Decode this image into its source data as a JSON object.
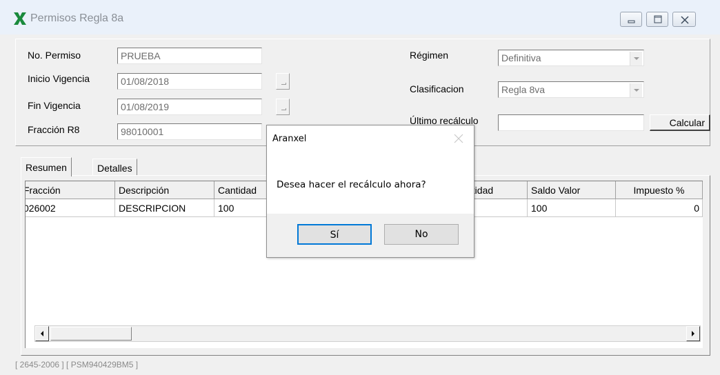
{
  "window": {
    "title": "Permisos Regla 8a",
    "controls": [
      "minimize-icon",
      "maximize-icon",
      "close-icon"
    ]
  },
  "form": {
    "permiso_label": "No. Permiso",
    "permiso_value": "PRUEBA",
    "inicio_label": "Inicio Vigencia",
    "inicio_value": "01/08/2018",
    "fin_label": "Fin Vigencia",
    "fin_value": "01/08/2019",
    "fraccion_label": "Fracción R8",
    "fraccion_value": "98010001",
    "regimen_label": "Régimen",
    "regimen_value": "Definitiva",
    "clasificacion_label": "Clasificacion",
    "clasificacion_value": "Regla 8va",
    "recalculo_label": "Último recálculo",
    "recalculo_value": "",
    "calcular_label": "Calcular"
  },
  "tabs": [
    {
      "label": "Resumen",
      "active": true
    },
    {
      "label": "Detalles",
      "active": false
    }
  ],
  "grid": {
    "columns": [
      "Fracción",
      "Descripción",
      "Cantidad",
      "",
      "ntidad",
      "Saldo Valor",
      "Impuesto %"
    ],
    "rows": [
      [
        "026002",
        "DESCRIPCION",
        "100",
        "",
        "",
        "100",
        "0"
      ]
    ]
  },
  "statusbar": "[ 2645-2006 ]  [ PSM940429BM5 ]",
  "dialog": {
    "title": "Aranxel",
    "message": "Desea hacer el recálculo ahora?",
    "yes_label": "Sí",
    "no_label": "No"
  },
  "colors": {
    "accent": "#0078d7",
    "logo": "#1a8a3c",
    "titlebar": "#eaf1fa"
  }
}
